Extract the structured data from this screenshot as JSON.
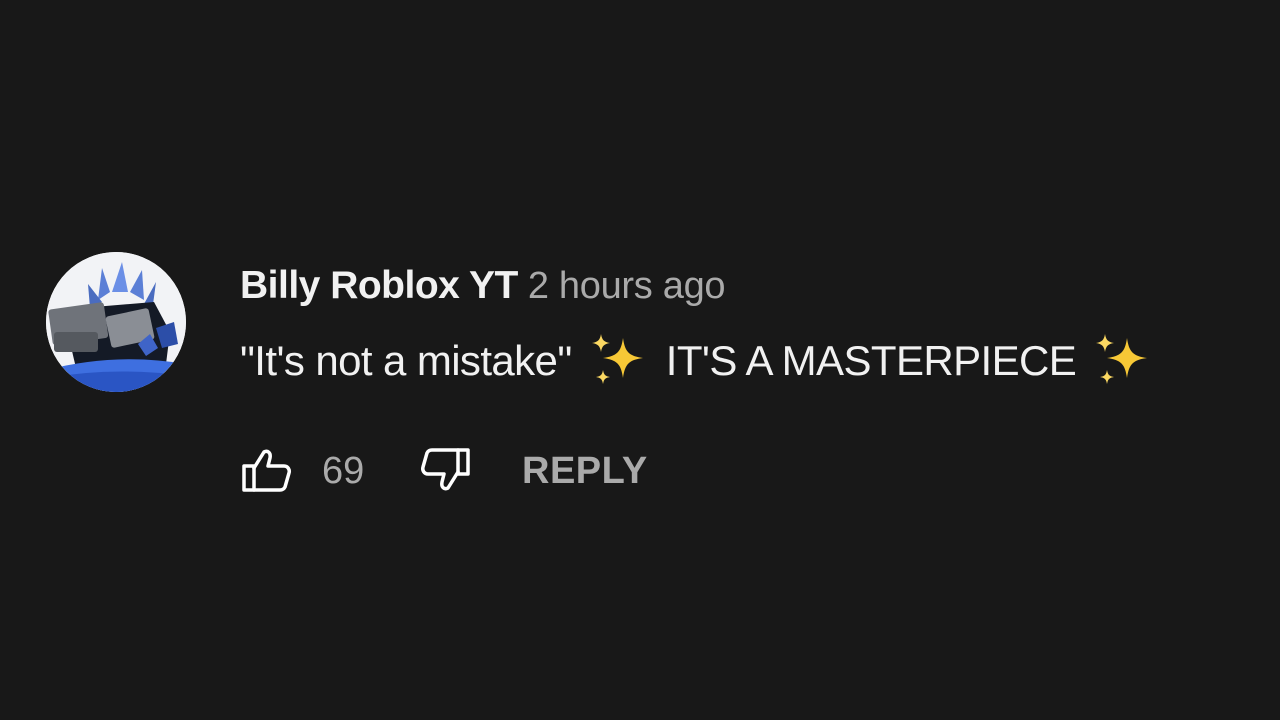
{
  "comment": {
    "author": "Billy Roblox YT",
    "timestamp": "2 hours ago",
    "text_part1": "\"It's not a mistake\"",
    "text_part2": "IT'S A MASTERPIECE",
    "emoji": "sparkles-emoji",
    "like_count": "69",
    "reply_label": "REPLY"
  },
  "icons": {
    "like": "thumbs-up-icon",
    "dislike": "thumbs-down-icon",
    "sparkles": "sparkles-icon"
  },
  "colors": {
    "background": "#181818",
    "primary_text": "#f1f1f1",
    "secondary_text": "#aaaaaa",
    "sparkle": "#f7c836"
  }
}
